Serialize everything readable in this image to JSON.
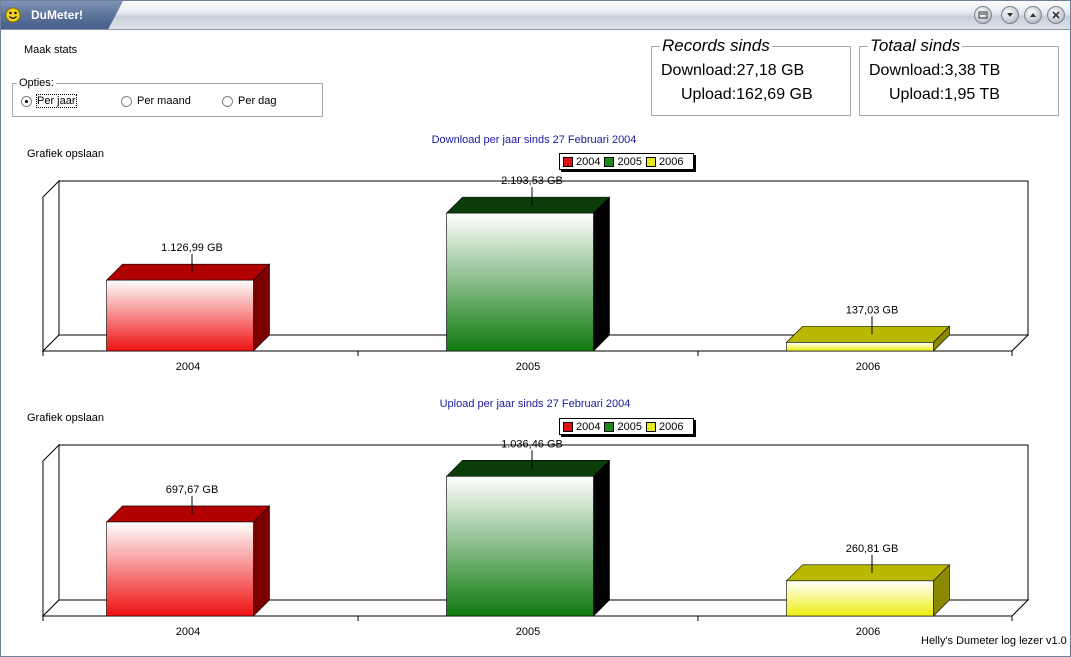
{
  "window": {
    "title": "DuMeter!"
  },
  "stats": {
    "make_label": "Maak stats"
  },
  "options": {
    "legend": "Opties:",
    "items": [
      {
        "label": "Per jaar",
        "selected": true
      },
      {
        "label": "Per maand",
        "selected": false
      },
      {
        "label": "Per dag",
        "selected": false
      }
    ]
  },
  "records": {
    "legend": "Records sinds",
    "download": "Download:27,18 GB",
    "upload": "Upload:162,69 GB"
  },
  "totals": {
    "legend": "Totaal sinds",
    "download": "Download:3,38 TB",
    "upload": "Upload:1,95 TB"
  },
  "colors": {
    "2004": "#e01010",
    "2005": "#1a8a1a",
    "2006": "#e8e820",
    "title_blue": "#1a1aa0"
  },
  "download_chart": {
    "save_label": "Grafiek opslaan"
  },
  "upload_chart": {
    "save_label": "Grafiek opslaan"
  },
  "footer": {
    "version": "Helly's Dumeter log lezer v1.0"
  },
  "chart_data": [
    {
      "type": "bar",
      "title": "Download per jaar sinds 27 Februari 2004",
      "categories": [
        "2004",
        "2005",
        "2006"
      ],
      "series": [
        {
          "name": "2004",
          "values": [
            1126.99
          ]
        },
        {
          "name": "2005",
          "values": [
            2193.53
          ]
        },
        {
          "name": "2006",
          "values": [
            137.03
          ]
        }
      ],
      "data_labels": [
        "1.126,99 GB",
        "2.193,53 GB",
        "137,03 GB"
      ],
      "legend": [
        "2004",
        "2005",
        "2006"
      ],
      "legend_position": "top-center",
      "ylim": [
        0,
        2450
      ],
      "grid": false
    },
    {
      "type": "bar",
      "title": "Upload per jaar sinds 27 Februari 2004",
      "categories": [
        "2004",
        "2005",
        "2006"
      ],
      "series": [
        {
          "name": "2004",
          "values": [
            697.67
          ]
        },
        {
          "name": "2005",
          "values": [
            1036.46
          ]
        },
        {
          "name": "2006",
          "values": [
            260.81
          ]
        }
      ],
      "data_labels": [
        "697,67 GB",
        "1.036,46 GB",
        "260,81 GB"
      ],
      "legend": [
        "2004",
        "2005",
        "2006"
      ],
      "legend_position": "top-center",
      "ylim": [
        0,
        1150
      ],
      "grid": false
    }
  ]
}
